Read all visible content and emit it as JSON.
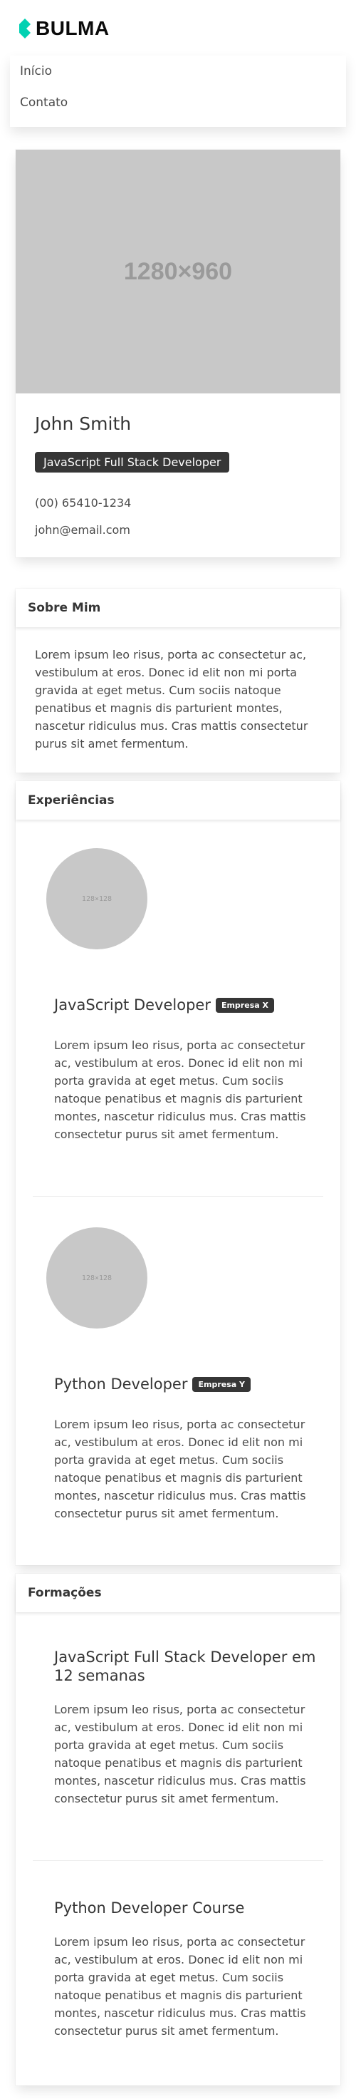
{
  "brand": {
    "name": "BULMA",
    "logo_icon": "bulma-logo-icon"
  },
  "nav": {
    "items": [
      "Início",
      "Contato"
    ]
  },
  "profile": {
    "image_placeholder": "1280×960",
    "name": "John Smith",
    "role": "JavaScript Full Stack Developer",
    "phone": "(00) 65410-1234",
    "email": "john@email.com"
  },
  "about": {
    "title": "Sobre Mim",
    "text": "Lorem ipsum leo risus, porta ac consectetur ac, vestibulum at eros. Donec id elit non mi porta gravida at eget metus. Cum sociis natoque penatibus et magnis dis parturient montes, nascetur ridiculus mus. Cras mattis consectetur purus sit amet fermentum."
  },
  "experiences": {
    "title": "Experiências",
    "items": [
      {
        "image_placeholder": "128×128",
        "title": "JavaScript Developer",
        "company": "Empresa X",
        "text": "Lorem ipsum leo risus, porta ac consectetur ac, vestibulum at eros. Donec id elit non mi porta gravida at eget metus. Cum sociis natoque penatibus et magnis dis parturient montes, nascetur ridiculus mus. Cras mattis consectetur purus sit amet fermentum."
      },
      {
        "image_placeholder": "128×128",
        "title": "Python Developer",
        "company": "Empresa Y",
        "text": "Lorem ipsum leo risus, porta ac consectetur ac, vestibulum at eros. Donec id elit non mi porta gravida at eget metus. Cum sociis natoque penatibus et magnis dis parturient montes, nascetur ridiculus mus. Cras mattis consectetur purus sit amet fermentum."
      }
    ]
  },
  "education": {
    "title": "Formações",
    "items": [
      {
        "title": "JavaScript Full Stack Developer em 12 semanas",
        "text": "Lorem ipsum leo risus, porta ac consectetur ac, vestibulum at eros. Donec id elit non mi porta gravida at eget metus. Cum sociis natoque penatibus et magnis dis parturient montes, nascetur ridiculus mus. Cras mattis consectetur purus sit amet fermentum."
      },
      {
        "title": "Python Developer Course",
        "text": "Lorem ipsum leo risus, porta ac consectetur ac, vestibulum at eros. Donec id elit non mi porta gravida at eget metus. Cum sociis natoque penatibus et magnis dis parturient montes, nascetur ridiculus mus. Cras mattis consectetur purus sit amet fermentum."
      }
    ]
  },
  "colors": {
    "brand": "#00d1b2",
    "dark_tag": "#363636",
    "placeholder": "#c8c8c8"
  }
}
